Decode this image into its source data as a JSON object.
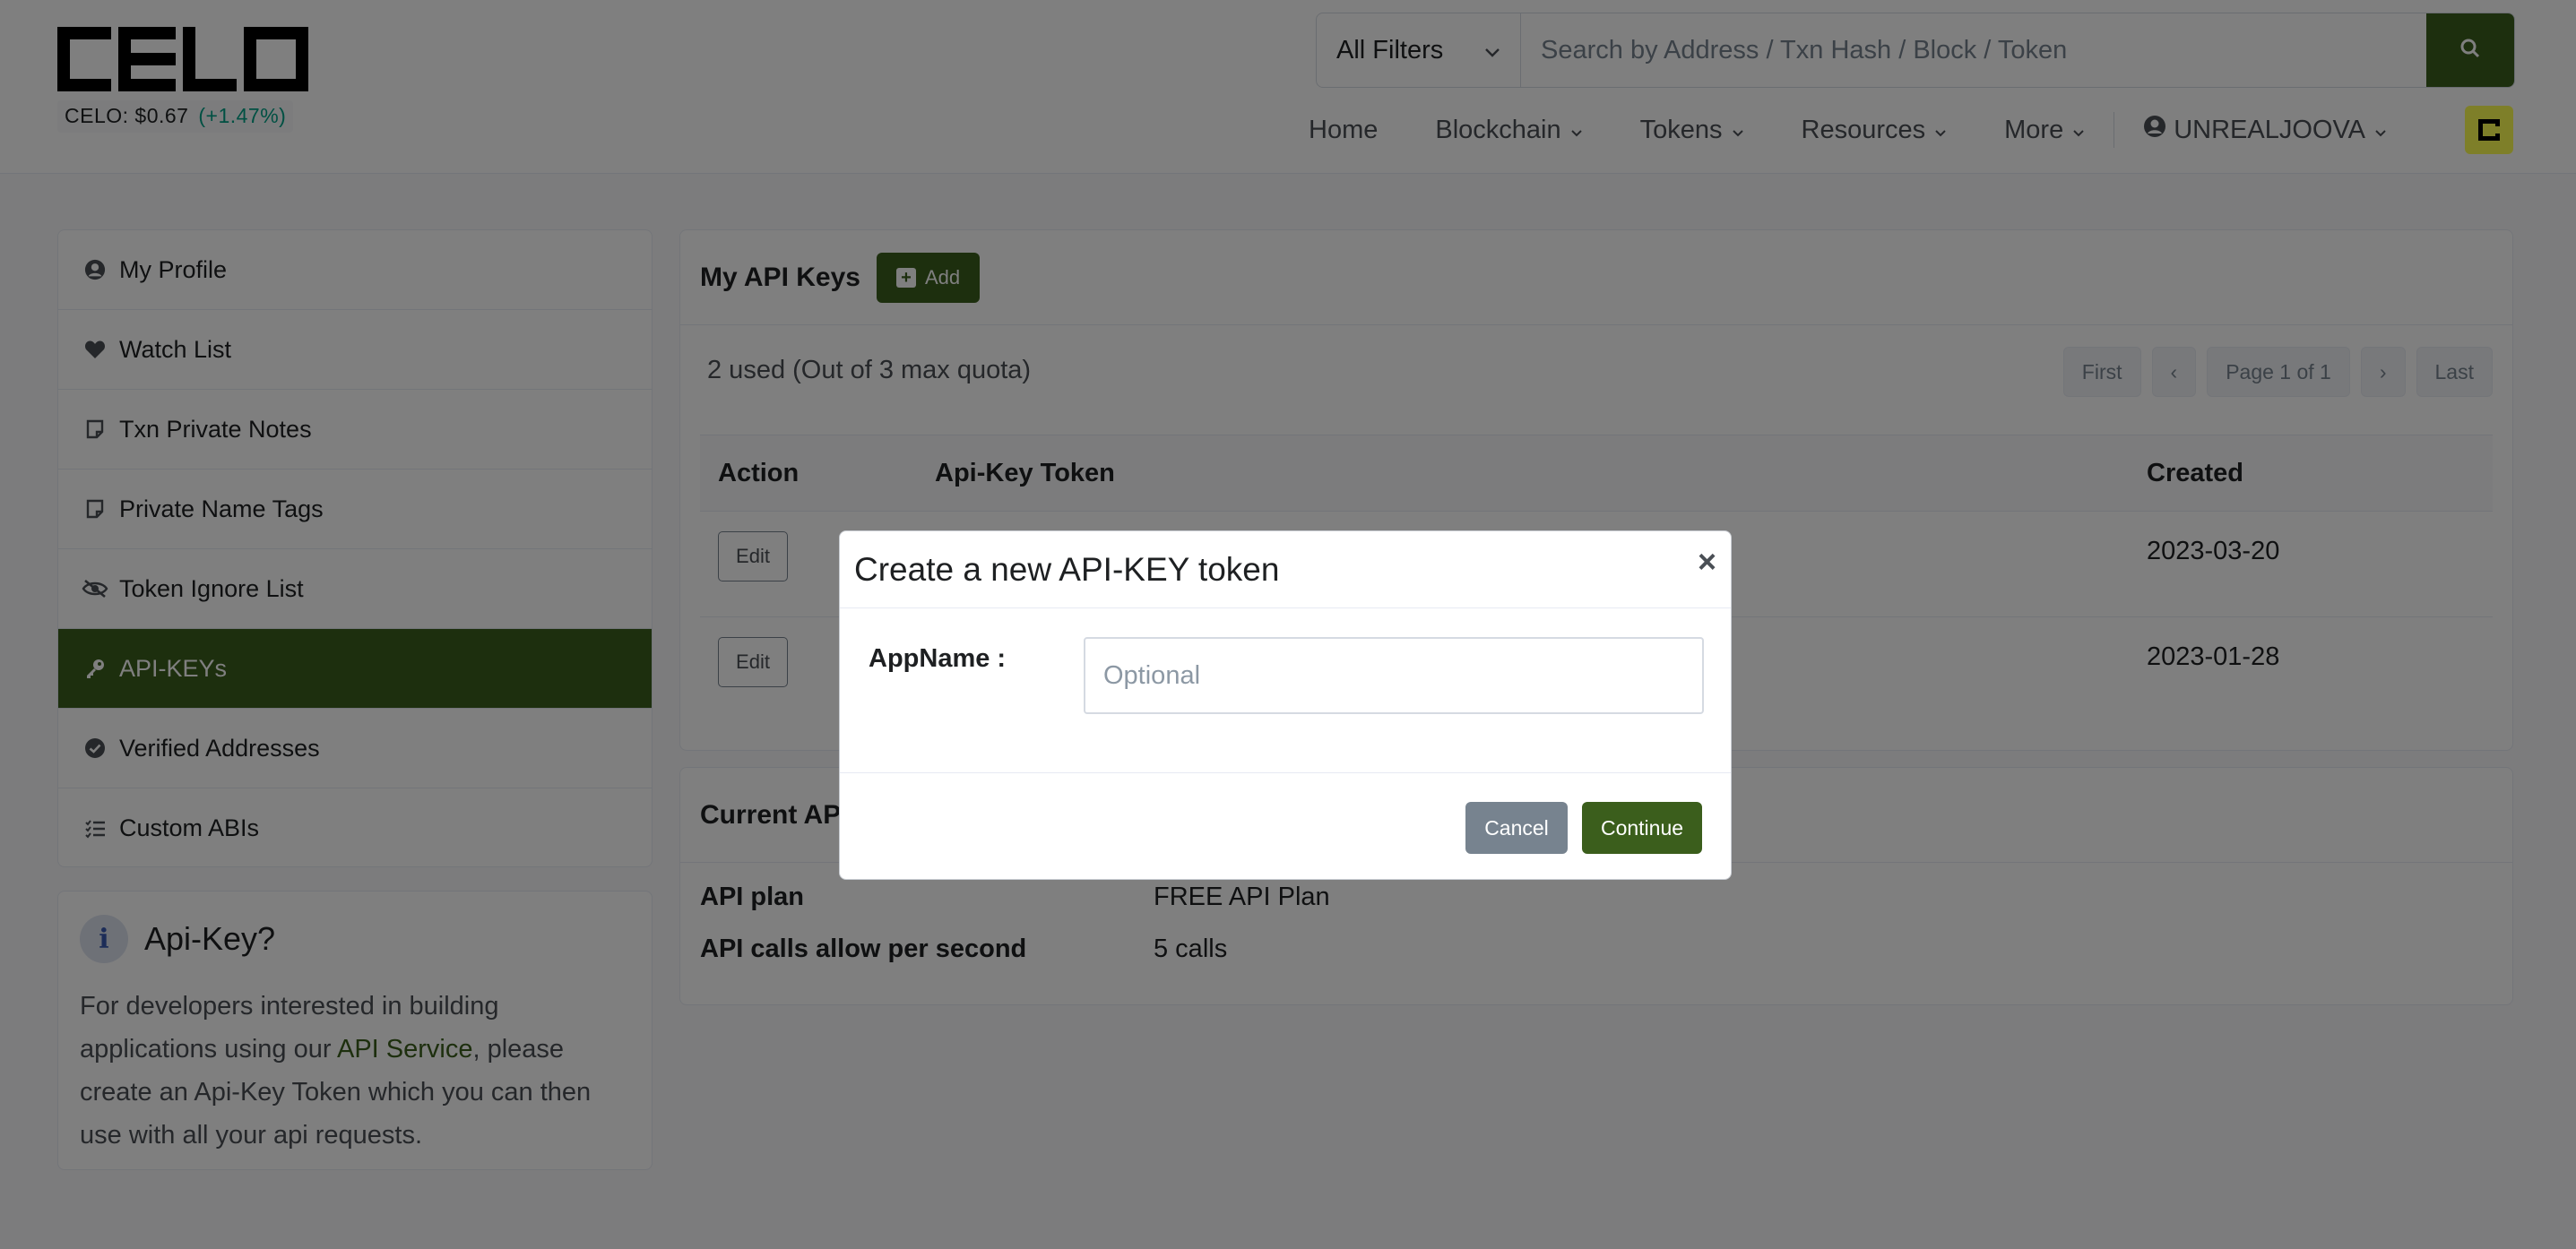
{
  "header": {
    "logo_text": "CELO",
    "price_label": "CELO: $0.67",
    "price_change": "(+1.47%)",
    "filter_selected": "All Filters",
    "search_placeholder": "Search by Address / Txn Hash / Block / Token",
    "nav": {
      "home": "Home",
      "blockchain": "Blockchain",
      "tokens": "Tokens",
      "resources": "Resources",
      "more": "More",
      "user": "UNREALJOOVA"
    }
  },
  "sidebar": {
    "items": [
      {
        "label": "My Profile",
        "icon": "user-circle-icon"
      },
      {
        "label": "Watch List",
        "icon": "heart-icon"
      },
      {
        "label": "Txn Private Notes",
        "icon": "note-icon"
      },
      {
        "label": "Private Name Tags",
        "icon": "note-icon"
      },
      {
        "label": "Token Ignore List",
        "icon": "eye-slash-icon"
      },
      {
        "label": "API-KEYs",
        "icon": "key-icon",
        "active": true
      },
      {
        "label": "Verified Addresses",
        "icon": "check-badge-icon"
      },
      {
        "label": "Custom ABIs",
        "icon": "list-icon"
      }
    ]
  },
  "info": {
    "title": "Api-Key?",
    "text_before": "For developers interested in building applications using our ",
    "link": "API Service",
    "text_after": ", please create an Api-Key Token which you can then use with all your api requests."
  },
  "api_keys": {
    "title": "My API Keys",
    "add_label": "Add",
    "quota": "2 used (Out of 3 max quota)",
    "pager": {
      "first": "First",
      "prev": "‹",
      "page": "Page 1 of 1",
      "next": "›",
      "last": "Last"
    },
    "columns": {
      "action": "Action",
      "token": "Api-Key Token",
      "created": "Created"
    },
    "rows": [
      {
        "action": "Edit",
        "created": "2023-03-20"
      },
      {
        "action": "Edit",
        "created": "2023-01-28"
      }
    ]
  },
  "plan": {
    "title": "Current API",
    "rows": [
      {
        "key": "API plan",
        "value": "FREE API Plan"
      },
      {
        "key": "API calls allow per second",
        "value": "5 calls"
      }
    ]
  },
  "modal": {
    "title": "Create a new API-KEY token",
    "close": "×",
    "field_label": "AppName :",
    "field_placeholder": "Optional",
    "field_value": "",
    "cancel": "Cancel",
    "continue": "Continue"
  },
  "colors": {
    "brand": "#3b5e1c",
    "accent_yellow": "#fcff52",
    "positive": "#00a186"
  }
}
